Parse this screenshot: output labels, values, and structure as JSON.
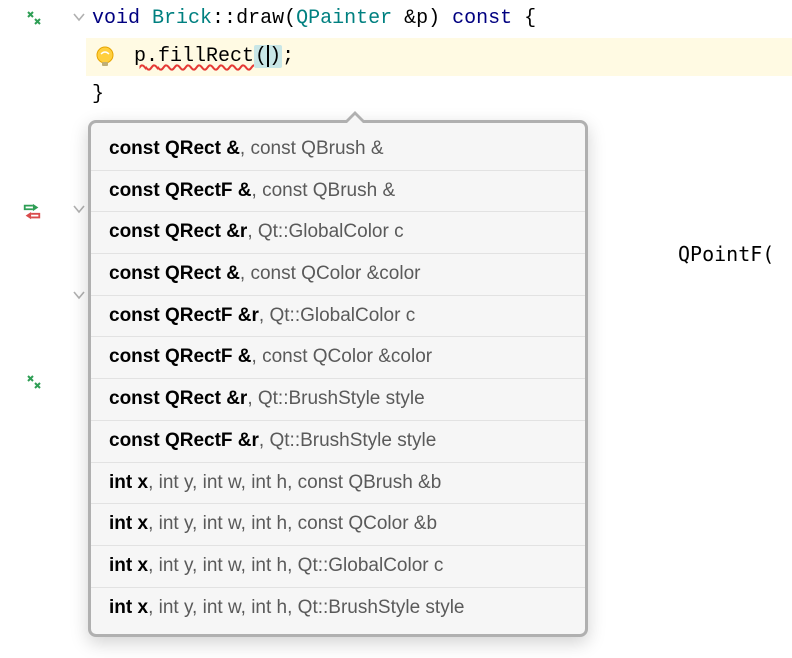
{
  "code": {
    "line1": {
      "kw_void": "void",
      "class": "Brick",
      "scope": "::",
      "method": "draw",
      "paren_open": "(",
      "param_type": "QPainter",
      "param_ref": " &",
      "param_name": "p",
      "paren_close": ")",
      "kw_const": " const",
      "brace": " {"
    },
    "line2": {
      "obj": "p",
      "dot": ".",
      "call": "fillRect",
      "args_open": "(",
      "caret": "|",
      "args_close": ")",
      "semi": ";"
    },
    "line3": {
      "brace_close": "}"
    }
  },
  "gutter": {
    "icon1": "override-icon",
    "icon2": "diff-icon",
    "icon3": "override-icon"
  },
  "hints": [
    {
      "first": "const QRect &",
      "rest": ", const QBrush &"
    },
    {
      "first": "const QRectF &",
      "rest": ", const QBrush &"
    },
    {
      "first": "const QRect &r",
      "rest": ", Qt::GlobalColor c"
    },
    {
      "first": "const QRect &",
      "rest": ", const QColor &color"
    },
    {
      "first": "const QRectF &r",
      "rest": ", Qt::GlobalColor c"
    },
    {
      "first": "const QRectF &",
      "rest": ", const QColor &color"
    },
    {
      "first": "const QRect &r",
      "rest": ", Qt::BrushStyle style"
    },
    {
      "first": "const QRectF &r",
      "rest": ", Qt::BrushStyle style"
    },
    {
      "first": "int x",
      "rest": ", int y, int w, int h, const QBrush &b"
    },
    {
      "first": "int x",
      "rest": ", int y, int w, int h, const QColor &b"
    },
    {
      "first": "int x",
      "rest": ", int y, int w, int h, Qt::GlobalColor c"
    },
    {
      "first": "int x",
      "rest": ", int y, int w, int h, Qt::BrushStyle style"
    }
  ],
  "floating": {
    "qpointf": "QPointF("
  },
  "intent": {
    "bulb_name": "intention-bulb"
  }
}
